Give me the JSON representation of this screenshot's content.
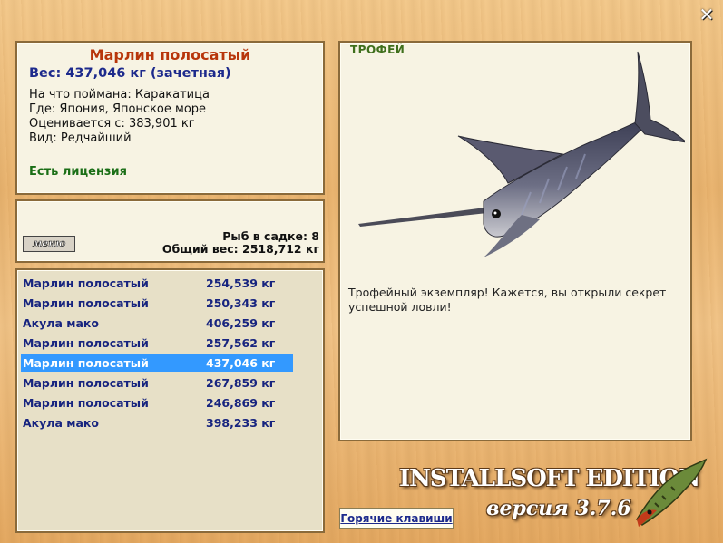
{
  "info": {
    "fish_name": "Марлин полосатый",
    "weight": "Вес: 437,046 кг (зачетная)",
    "caught_on": "На что поймана: Каракатица",
    "where": "Где: Япония, Японское море",
    "valued_from": "Оценивается с: 383,901 кг",
    "kind": "Вид: Редчайший",
    "license": "Есть лицензия"
  },
  "stats": {
    "menu_label": "меню",
    "fish_count": "Рыб в садке: 8",
    "total_weight": "Общий вес: 2518,712 кг"
  },
  "catch_list": [
    {
      "name": "Марлин полосатый",
      "weight": "254,539 кг"
    },
    {
      "name": "Марлин полосатый",
      "weight": "250,343 кг"
    },
    {
      "name": "Акула мако",
      "weight": "406,259 кг"
    },
    {
      "name": "Марлин полосатый",
      "weight": "257,562 кг"
    },
    {
      "name": "Марлин полосатый",
      "weight": "437,046 кг",
      "selected": true
    },
    {
      "name": "Марлин полосатый",
      "weight": "267,859 кг"
    },
    {
      "name": "Марлин полосатый",
      "weight": "246,869 кг"
    },
    {
      "name": "Акула мако",
      "weight": "398,233 кг"
    }
  ],
  "trophy": {
    "title": "ТРОФЕЙ",
    "text": "Трофейный экземпляр! Кажется, вы открыли секрет успешной ловли!"
  },
  "footer": {
    "hotkeys_label": "Горячие клавиши",
    "brand": "INSTALLSOFT EDITION",
    "version": "версия 3.7.6"
  },
  "icons": {
    "close": "close-icon",
    "trophy_image": "marlin-image",
    "logo": "pike-logo"
  },
  "colors": {
    "selection": "#3399ff",
    "fish_name": "#b8360b",
    "list_text": "#17247f",
    "license": "#1a6e16"
  }
}
